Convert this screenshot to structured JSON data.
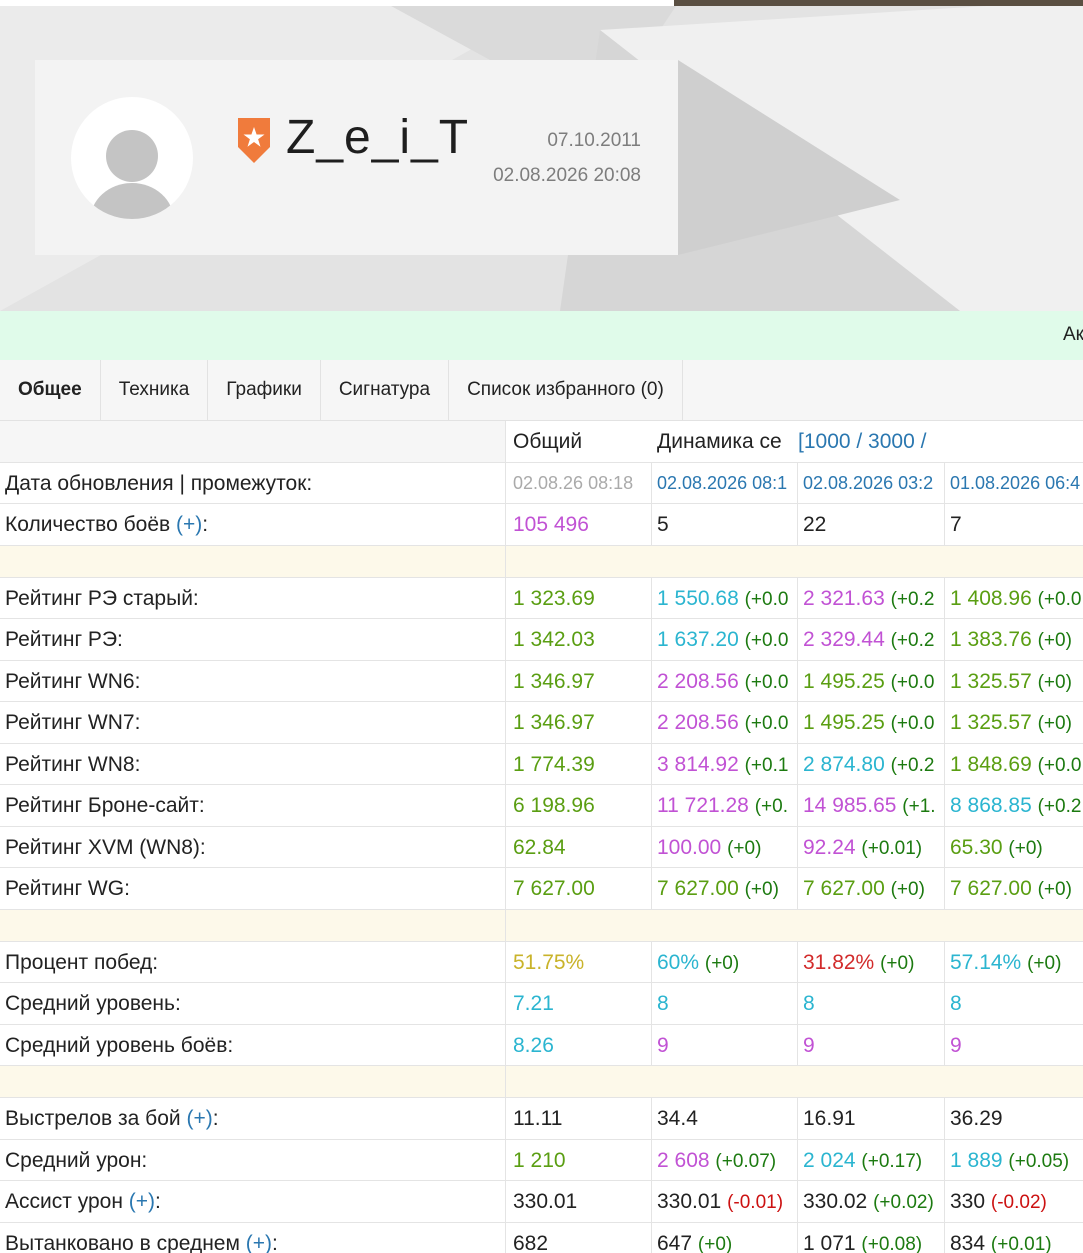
{
  "profile": {
    "nickname": "Z_e_i_T",
    "registration_date": "07.10.2011",
    "last_update": "02.08.2026 20:08"
  },
  "strip_text": "Ак",
  "tabs": [
    {
      "label": "Общее",
      "active": true
    },
    {
      "label": "Техника"
    },
    {
      "label": "Графики"
    },
    {
      "label": "Сигнатура"
    },
    {
      "label": "Список избранного (0)"
    }
  ],
  "table": {
    "header": {
      "total": "Общий",
      "dynamics": "Динамика се",
      "dynamics_link": "[1000 / 3000 /"
    },
    "update_row": {
      "label": "Дата обновления | промежуток:",
      "total": "02.08.26 08:18",
      "p1": "02.08.2026 08:1",
      "p2": "02.08.2026 03:2",
      "p3": "01.08.2026 06:4"
    },
    "battles_row": {
      "label": "Количество боёв",
      "plus": "(+)",
      "colon": ":",
      "total": "105 496",
      "p1": "5",
      "p2": "22",
      "p3": "7"
    },
    "ratings": [
      {
        "label": "Рейтинг РЭ старый:",
        "total": "1 323.69",
        "p1": "1 550.68",
        "d1": "(+0.0",
        "p2": "2 321.63",
        "d2": "(+0.2",
        "p3": "1 408.96",
        "d3": "(+0.0"
      },
      {
        "label": "Рейтинг РЭ:",
        "total": "1 342.03",
        "p1": "1 637.20",
        "d1": "(+0.0",
        "p2": "2 329.44",
        "d2": "(+0.2",
        "p3": "1 383.76",
        "d3": "(+0)"
      },
      {
        "label": "Рейтинг WN6:",
        "total": "1 346.97",
        "p1": "2 208.56",
        "d1": "(+0.0",
        "p2": "1 495.25",
        "d2": "(+0.0",
        "p3": "1 325.57",
        "d3": "(+0)"
      },
      {
        "label": "Рейтинг WN7:",
        "total": "1 346.97",
        "p1": "2 208.56",
        "d1": "(+0.0",
        "p2": "1 495.25",
        "d2": "(+0.0",
        "p3": "1 325.57",
        "d3": "(+0)"
      },
      {
        "label": "Рейтинг WN8:",
        "total": "1 774.39",
        "p1": "3 814.92",
        "d1": "(+0.1",
        "p2": "2 874.80",
        "d2": "(+0.2",
        "p3": "1 848.69",
        "d3": "(+0.0"
      },
      {
        "label": "Рейтинг Броне-сайт:",
        "total": "6 198.96",
        "p1": "11 721.28",
        "d1": "(+0.",
        "p2": "14 985.65",
        "d2": "(+1.",
        "p3": "8 868.85",
        "d3": "(+0.2"
      },
      {
        "label": "Рейтинг XVM (WN8):",
        "total": "62.84",
        "p1": "100.00",
        "d1": "(+0)",
        "p2": "92.24",
        "d2": "(+0.01)",
        "p3": "65.30",
        "d3": "(+0)"
      },
      {
        "label": "Рейтинг WG:",
        "total": "7 627.00",
        "p1": "7 627.00",
        "d1": "(+0)",
        "p2": "7 627.00",
        "d2": "(+0)",
        "p3": "7 627.00",
        "d3": "(+0)"
      }
    ],
    "general": [
      {
        "label": "Процент побед:",
        "total": "51.75%",
        "p1": "60%",
        "d1": "(+0)",
        "p2": "31.82%",
        "d2": "(+0)",
        "p3": "57.14%",
        "d3": "(+0)"
      },
      {
        "label": "Средний уровень:",
        "total": "7.21",
        "p1": "8",
        "p2": "8",
        "p3": "8"
      },
      {
        "label": "Средний уровень боёв:",
        "total": "8.26",
        "p1": "9",
        "p2": "9",
        "p3": "9"
      }
    ],
    "combat": [
      {
        "label": "Выстрелов за бой",
        "plus": "(+)",
        "colon": ":",
        "total": "11.11",
        "p1": "34.4",
        "p2": "16.91",
        "p3": "36.29"
      },
      {
        "label": "Средний урон:",
        "total": "1 210",
        "p1": "2 608",
        "d1": "(+0.07)",
        "p2": "2 024",
        "d2": "(+0.17)",
        "p3": "1 889",
        "d3": "(+0.05)"
      },
      {
        "label": "Ассист урон",
        "plus": "(+)",
        "colon": ":",
        "total": "330.01",
        "p1": "330.01",
        "d1": "(-0.01)",
        "p2": "330.02",
        "d2": "(+0.02)",
        "p3": "330",
        "d3": "(-0.02)"
      },
      {
        "label": "Вытанковано в среднем",
        "plus": "(+)",
        "colon": ":",
        "total": "682",
        "p1": "647",
        "d1": "(+0)",
        "p2": "1 071",
        "d2": "(+0.08)",
        "p3": "834",
        "d3": "(+0.01)"
      }
    ]
  },
  "colors": {
    "green": "#5a9e12",
    "cyan": "#2bb5d0",
    "purple": "#c152d4",
    "red": "#d22b2b",
    "yellow": "#c9b32a",
    "badge": "#f07b3c",
    "strip_bg": "#e0fbea",
    "separator_bg": "#fdf9ea"
  },
  "icons": [
    "avatar-placeholder-icon",
    "clan-badge-icon"
  ]
}
